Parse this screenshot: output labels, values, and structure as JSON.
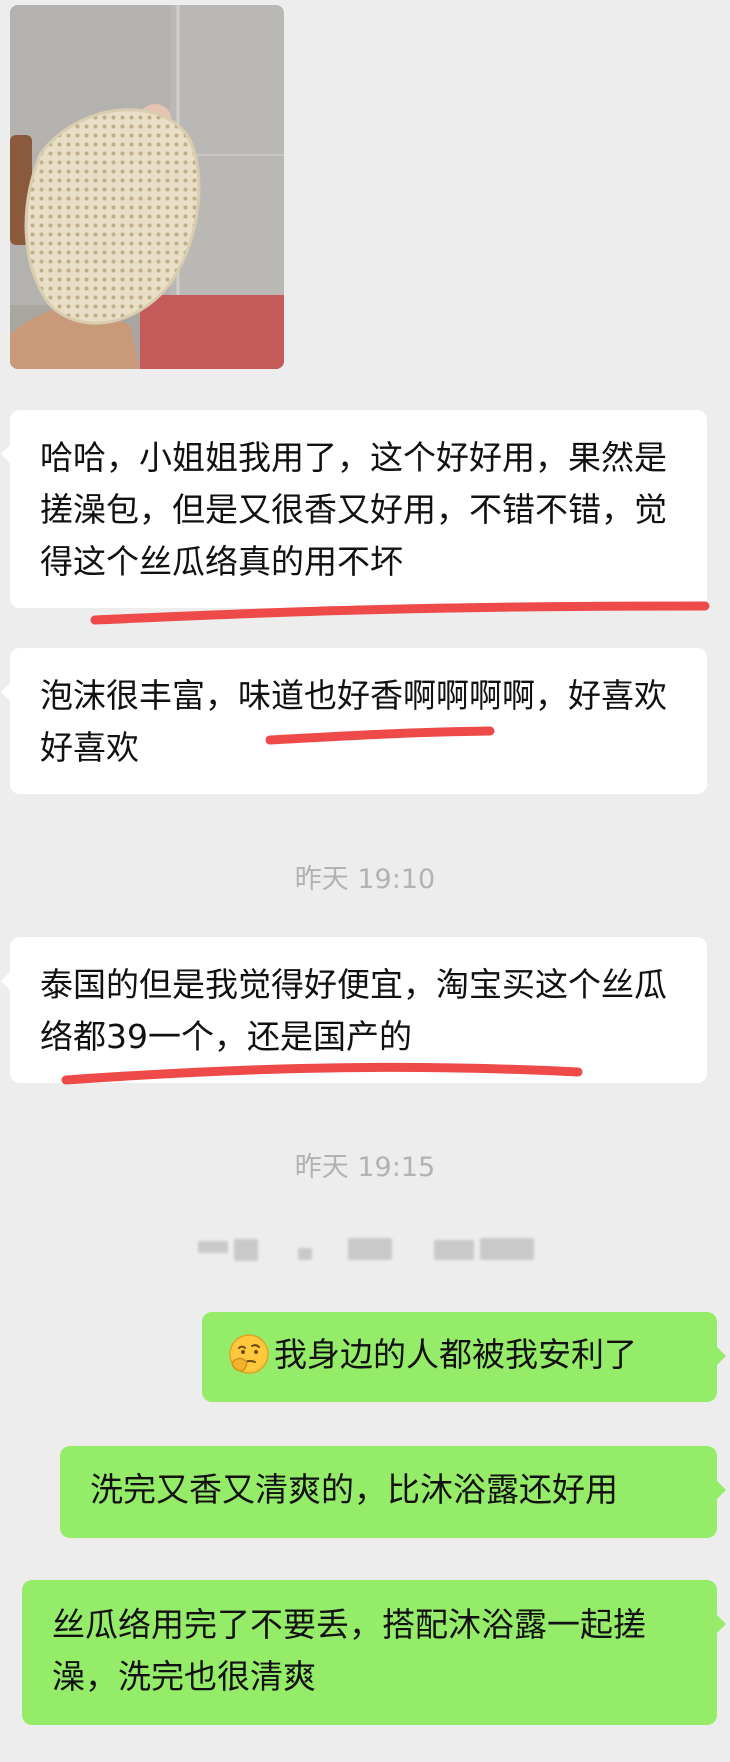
{
  "messages": [
    {
      "text": "哈哈，小姐姐我用了，这个好好用，果然是搓澡包，但是又很香又好用，不错不错，觉得这个丝瓜络真的用不坏"
    },
    {
      "text": "泡沫很丰富，味道也好香啊啊啊啊，好喜欢好喜欢"
    },
    {
      "text": "泰国的但是我觉得好便宜，淘宝买这个丝瓜络都39一个，还是国产的"
    },
    {
      "text": "我身边的人都被我安利了",
      "emoji": "thinking-face"
    },
    {
      "text": "洗完又香又清爽的，比沐浴露还好用"
    },
    {
      "text": "丝瓜络用完了不要丢，搭配沐浴露一起搓澡，洗完也很清爽"
    }
  ],
  "timestamps": [
    "昨天 19:10",
    "昨天 19:15"
  ],
  "colors": {
    "background": "#ededed",
    "incoming_bubble": "#ffffff",
    "outgoing_bubble": "#95ec69",
    "underline": "#ee4a4a",
    "timestamp": "#b2b2b2"
  }
}
